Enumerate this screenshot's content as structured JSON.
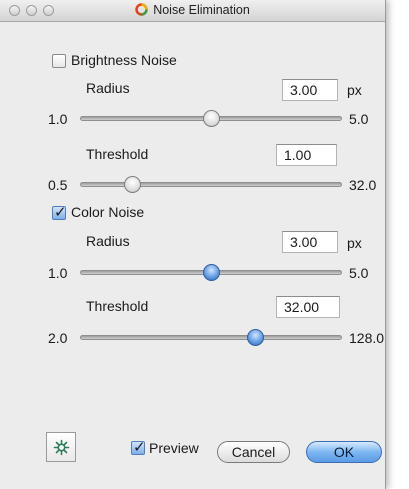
{
  "window": {
    "title": "Noise Elimination",
    "controls": [
      "close-button",
      "minimize-button",
      "zoom-button"
    ]
  },
  "brightness_noise": {
    "label": "Brightness Noise",
    "checked": false,
    "radius": {
      "label": "Radius",
      "value": "3.00",
      "unit": "px",
      "min_label": "1.0",
      "max_label": "5.0",
      "level": 0.5
    },
    "threshold": {
      "label": "Threshold",
      "value": "1.00",
      "min_label": "0.5",
      "max_label": "32.0",
      "level": 0.2
    }
  },
  "color_noise": {
    "label": "Color Noise",
    "checked": true,
    "radius": {
      "label": "Radius",
      "value": "3.00",
      "unit": "px",
      "min_label": "1.0",
      "max_label": "5.0",
      "level": 0.5
    },
    "threshold": {
      "label": "Threshold",
      "value": "32.00",
      "min_label": "2.0",
      "max_label": "128.0",
      "level": 0.67
    }
  },
  "footer": {
    "icon": "gear-icon",
    "preview_label": "Preview",
    "preview_checked": true,
    "cancel_label": "Cancel",
    "ok_label": "OK"
  },
  "colors": {
    "accent_blue": "#5b9be6",
    "window_bg": "#ececec"
  }
}
